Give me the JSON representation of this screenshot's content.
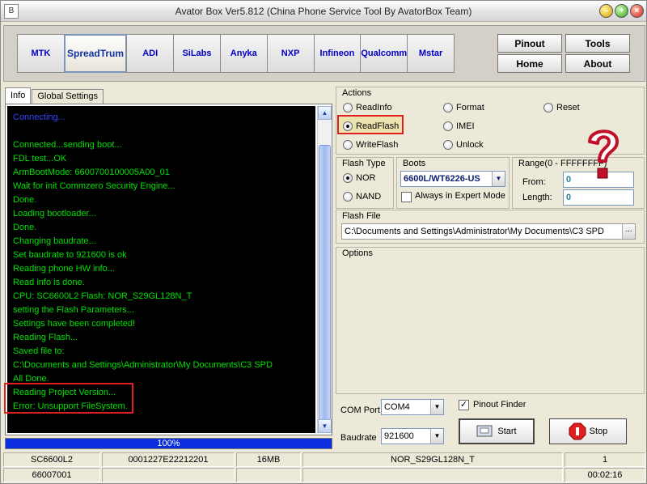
{
  "window": {
    "title": "Avator Box Ver5.812 (China Phone Service Tool By AvatorBox Team)",
    "icon_glyph": "B"
  },
  "platforms": [
    "MTK",
    "SpreadTrum",
    "ADI",
    "SiLabs",
    "Anyka",
    "NXP",
    "Infineon",
    "Qualcomm",
    "Mstar"
  ],
  "active_platform": "SpreadTrum",
  "nav": {
    "pinout": "Pinout",
    "tools": "Tools",
    "home": "Home",
    "about": "About"
  },
  "tabs": {
    "info": "Info",
    "global_settings": "Global Settings"
  },
  "log": [
    "Connecting...",
    "",
    "Connected...sending boot...",
    "FDL test...OK",
    "ArmBootMode: 6600700100005A00_01",
    "Wait for init Commzero Security Engine...",
    "Done.",
    "Loading bootloader...",
    "Done.",
    "Changing baudrate...",
    "Set baudrate to 921600 is ok",
    "Reading phone HW info...",
    "Read info is done.",
    "CPU: SC6600L2      Flash: NOR_S29GL128N_T",
    "setting the Flash Parameters...",
    "Settings have been completed!",
    "Reading Flash...",
    "Saved file to:",
    "C:\\Documents and Settings\\Administrator\\My Documents\\C3 SPD",
    "All Done.",
    "Reading Project Version...",
    "Error: Unsupport FileSystem."
  ],
  "progress": {
    "percent": 100,
    "label": "100%"
  },
  "actions": {
    "title": "Actions",
    "options": [
      "ReadInfo",
      "Format",
      "Reset",
      "ReadFlash",
      "IMEI",
      "WriteFlash",
      "Unlock"
    ],
    "selected": "ReadFlash"
  },
  "flash_type": {
    "title": "Flash Type",
    "nor": "NOR",
    "nand": "NAND",
    "selected": "NOR"
  },
  "boots": {
    "title": "Boots",
    "value": "6600L/WT6226-US",
    "expert_label": "Always in Expert Mode",
    "expert_checked": false
  },
  "range": {
    "title": "Range(0 - FFFFFFFF)",
    "from_label": "From:",
    "from_value": "0",
    "length_label": "Length:",
    "length_value": "0"
  },
  "flash_file": {
    "title": "Flash File",
    "path": "C:\\Documents and Settings\\Administrator\\My Documents\\C3 SPD",
    "browse": "..."
  },
  "options": {
    "title": "Options"
  },
  "com": {
    "port_label": "COM Port",
    "port_value": "COM4",
    "baud_label": "Baudrate",
    "baud_value": "921600",
    "pinout_finder_label": "Pinout Finder",
    "pinout_finder_checked": true
  },
  "buttons": {
    "start": "Start",
    "stop": "Stop"
  },
  "status": {
    "row1": [
      "SC6600L2",
      "0001227E22212201",
      "16MB",
      "NOR_S29GL128N_T",
      "1"
    ],
    "row2": [
      "66007001",
      "",
      "",
      "",
      "00:02:16"
    ]
  },
  "colors": {
    "log_text": "#00e000",
    "progress": "#0a2ee0",
    "highlight": "#e02020",
    "platform_text": "#0000c8"
  }
}
